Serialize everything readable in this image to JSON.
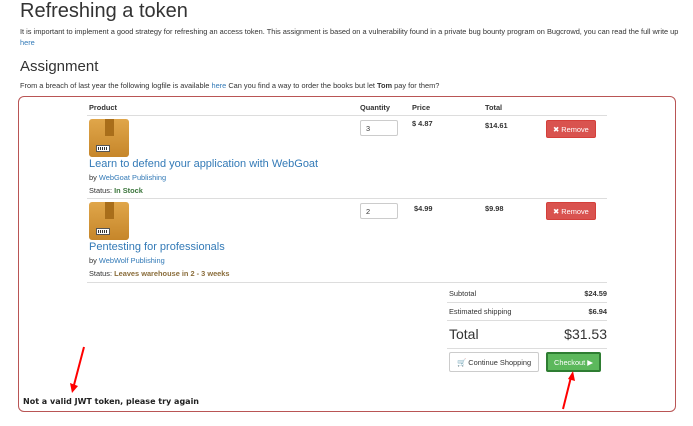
{
  "page": {
    "title": "Refreshing a token",
    "intro_text": "It is important to implement a good strategy for refreshing an access token. This assignment is based on a vulnerability found in a private bug bounty program on Bugcrowd, you can read the full write up",
    "intro_link": "here",
    "assignment_heading": "Assignment",
    "breach_text_before": "From a breach of last year the following logfile is available",
    "breach_link": "here",
    "breach_text_middle": "Can you find a way to order the books but let",
    "breach_name": "Tom",
    "breach_text_after": "pay for them?"
  },
  "cart": {
    "headers": {
      "product": "Product",
      "quantity": "Quantity",
      "price": "Price",
      "total": "Total"
    },
    "items": [
      {
        "name": "Learn to defend your application with WebGoat",
        "by_label": "by",
        "publisher": "WebGoat Publishing",
        "status_label": "Status:",
        "status": "In Stock",
        "quantity": "3",
        "price": "$ 4.87",
        "total": "$14.61",
        "remove_label": "Remove"
      },
      {
        "name": "Pentesting for professionals",
        "by_label": "by",
        "publisher": "WebWolf Publishing",
        "status_label": "Status:",
        "status": "Leaves warehouse in 2 - 3 weeks",
        "quantity": "2",
        "price": "$4.99",
        "total": "$9.98",
        "remove_label": "Remove"
      }
    ],
    "subtotal_label": "Subtotal",
    "subtotal": "$24.59",
    "shipping_label": "Estimated shipping",
    "shipping": "$6.94",
    "total_label": "Total",
    "total": "$31.53",
    "continue_label": "Continue Shopping",
    "checkout_label": "Checkout"
  },
  "feedback": "Not a valid JWT token, please try again",
  "colors": {
    "link": "#337ab7",
    "remove": "#d9534f",
    "checkout": "#5cb85c",
    "annotation_arrow": "#ff0000",
    "cart_border": "#b95555"
  },
  "icons": {
    "remove": "times-icon",
    "continue": "cart-icon",
    "checkout": "play-icon",
    "thumbnail": "book-box-icon"
  }
}
